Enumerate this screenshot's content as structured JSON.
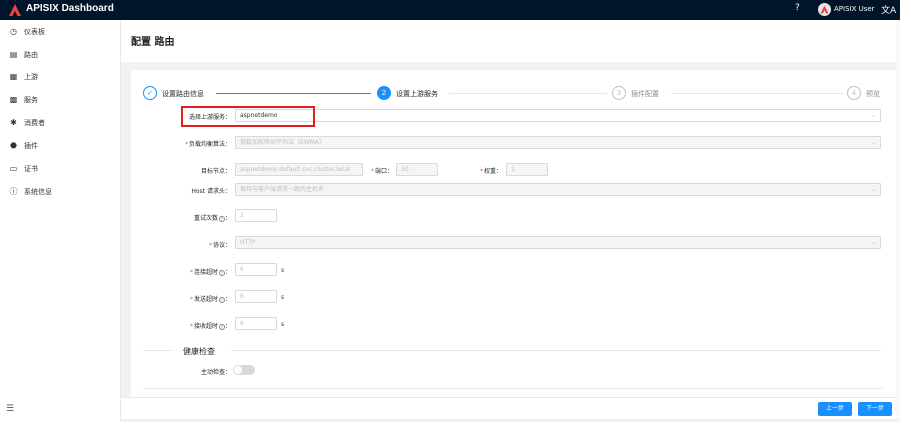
{
  "app": {
    "title": "APISIX Dashboard",
    "user": "APISIX User"
  },
  "topbar": {
    "help_icon": "?",
    "lang_icon": "文A"
  },
  "sidebar": {
    "items": [
      {
        "label": "仪表板",
        "icon": "◷"
      },
      {
        "label": "路由",
        "icon": "▤"
      },
      {
        "label": "上游",
        "icon": "▦"
      },
      {
        "label": "服务",
        "icon": "▩"
      },
      {
        "label": "消费者",
        "icon": "✱"
      },
      {
        "label": "插件",
        "icon": "⬣"
      },
      {
        "label": "证书",
        "icon": "▭"
      },
      {
        "label": "系统信息",
        "icon": "ⓘ"
      }
    ],
    "collapse_icon": "☰"
  },
  "page": {
    "title": "配置 路由"
  },
  "steps": [
    {
      "num": "✓",
      "label": "设置路由信息"
    },
    {
      "num": "2",
      "label": "设置上游服务"
    },
    {
      "num": "3",
      "label": "插件配置"
    },
    {
      "num": "4",
      "label": "预览"
    }
  ],
  "form": {
    "upstream_label": "选择上游服务：",
    "upstream_value": "aspnetdemo",
    "lb_label": "负载均衡算法：",
    "lb_value": "指数加权移动平均法（EWMA）",
    "target_label": "目标节点：",
    "target_value": "aspnetdemo.default.svc.cluster.local",
    "port_label": "端口：",
    "port_value": "30",
    "weight_label": "权重：",
    "weight_value": "1",
    "host_label": "Host 请求头：",
    "host_value": "保持与客户端请求一致的主机名",
    "retries_label": "重试次数",
    "retries_value": "2",
    "protocol_label": "协议：",
    "protocol_value": "HTTP",
    "connect_label": "连接超时",
    "connect_value": "6",
    "send_label": "发送超时",
    "send_value": "6",
    "read_label": "接收超时",
    "read_value": "6",
    "unit": "s",
    "health_title": "健康检查",
    "active_label": "主动检查："
  },
  "footer": {
    "prev": "上一步",
    "next": "下一步"
  },
  "colors": {
    "primary": "#1890ff",
    "header": "#001529",
    "highlight": "#e02020"
  }
}
